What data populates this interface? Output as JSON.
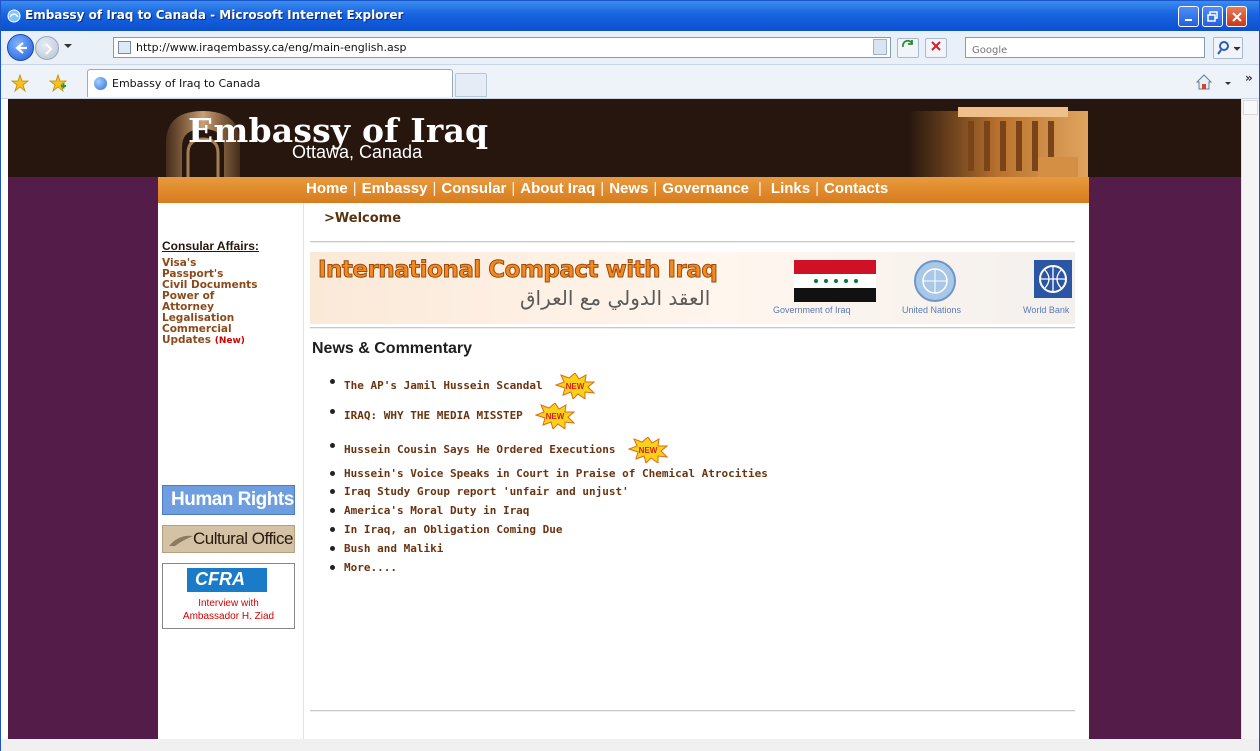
{
  "window": {
    "title": "Embassy of Iraq to Canada - Microsoft Internet Explorer"
  },
  "address_bar": {
    "url": "http://www.iraqembassy.ca/eng/main-english.asp",
    "search_placeholder": "Google"
  },
  "tab": {
    "label": "Embassy of Iraq to Canada"
  },
  "site": {
    "title": "Embassy of Iraq",
    "subtitle": "Ottawa, Canada"
  },
  "nav": {
    "items": [
      "Home",
      "Embassy",
      "Consular",
      "About Iraq",
      "News",
      "Governance",
      "Links",
      "Contacts"
    ]
  },
  "breadcrumb": ">Welcome",
  "sidebar": {
    "section_title": "Consular Affairs:",
    "links": [
      "Visa's",
      "Passport's",
      "Civil Documents",
      "Power of",
      "Attorney",
      "Legalisation",
      "Commercial",
      "Updates"
    ],
    "new_tag": "(New)",
    "human_rights": "Human Rights",
    "cultural_office": "Cultural Office",
    "cfra_logo": "CFRA",
    "cfra_line1": "Interview with",
    "cfra_line2": "Ambassador H. Ziad"
  },
  "compact_banner": {
    "headline": "International Compact with Iraq",
    "arabic": "العقد الدولي مع العراق",
    "gov_label": "Government of Iraq",
    "un_label": "United Nations",
    "wb_label": "World Bank"
  },
  "news": {
    "title": "News & Commentary",
    "items": [
      {
        "text": "The AP's Jamil Hussein Scandal",
        "new": true
      },
      {
        "text": "IRAQ: WHY THE MEDIA MISSTEP",
        "new": true
      },
      {
        "text": "Hussein Cousin Says He Ordered Executions",
        "new": true
      },
      {
        "text": "Hussein's Voice Speaks in Court in Praise of Chemical Atrocities",
        "new": false
      },
      {
        "text": "Iraq Study Group report 'unfair and unjust'",
        "new": false
      },
      {
        "text": "America's Moral Duty in Iraq",
        "new": false
      },
      {
        "text": "In Iraq, an Obligation Coming Due",
        "new": false
      },
      {
        "text": "Bush and Maliki",
        "new": false
      },
      {
        "text": "More....",
        "new": false
      }
    ],
    "new_badge": "NEW"
  },
  "colors": {
    "background": "#531c49",
    "header": "#26160e",
    "nav": "#d67c1e",
    "link": "#6b3411"
  }
}
